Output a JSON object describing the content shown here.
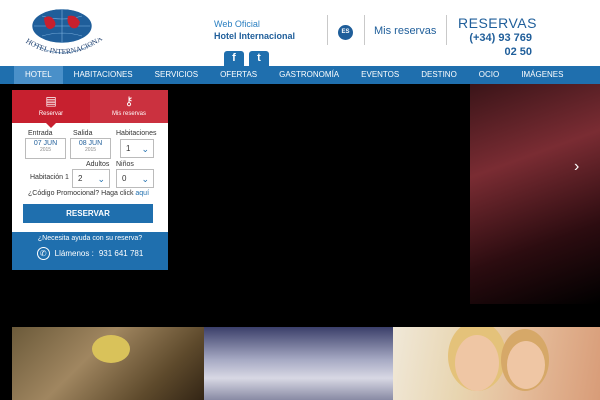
{
  "header": {
    "logo_text": "HOTEL INTERNACIONAL",
    "official_line1": "Web Oficial",
    "official_line2": "Hotel Internacional",
    "lang": "ES",
    "my_reservations": "Mis reservas",
    "reservas_title": "RESERVAS",
    "reservas_phone_line1": "(+34) 93 769",
    "reservas_phone_line2": "02 50",
    "social": {
      "facebook": "f",
      "twitter": "t"
    }
  },
  "nav": {
    "items": [
      "HOTEL",
      "HABITACIONES",
      "SERVICIOS",
      "OFERTAS",
      "GASTRONOMÍA",
      "EVENTOS",
      "DESTINO",
      "OCIO",
      "IMÁGENES"
    ],
    "active_index": 0
  },
  "booking": {
    "tabs": {
      "reservar": "Reservar",
      "mis_reservas": "Mis reservas"
    },
    "entrada_label": "Entrada",
    "salida_label": "Salida",
    "habitaciones_label": "Habitaciones",
    "entrada_value": "07 JUN",
    "entrada_year": "2015",
    "salida_value": "08 JUN",
    "salida_year": "2015",
    "habitaciones_value": "1",
    "adultos_label": "Adultos",
    "ninos_label": "Niños",
    "habitacion_label": "Habitación 1",
    "adultos_value": "2",
    "ninos_value": "0",
    "promo_text": "¿Código Promocional? Haga click",
    "promo_link": "aquí",
    "reservar_button": "RESERVAR",
    "help_text": "¿Necesita ayuda con su reserva?",
    "call_text": "Llámenos :",
    "call_number": "931  641  781"
  },
  "hero": {
    "next_arrow": "›"
  },
  "colors": {
    "brand_blue": "#1f6fae",
    "brand_red": "#c7202f",
    "nav_active": "#4a90c9"
  }
}
